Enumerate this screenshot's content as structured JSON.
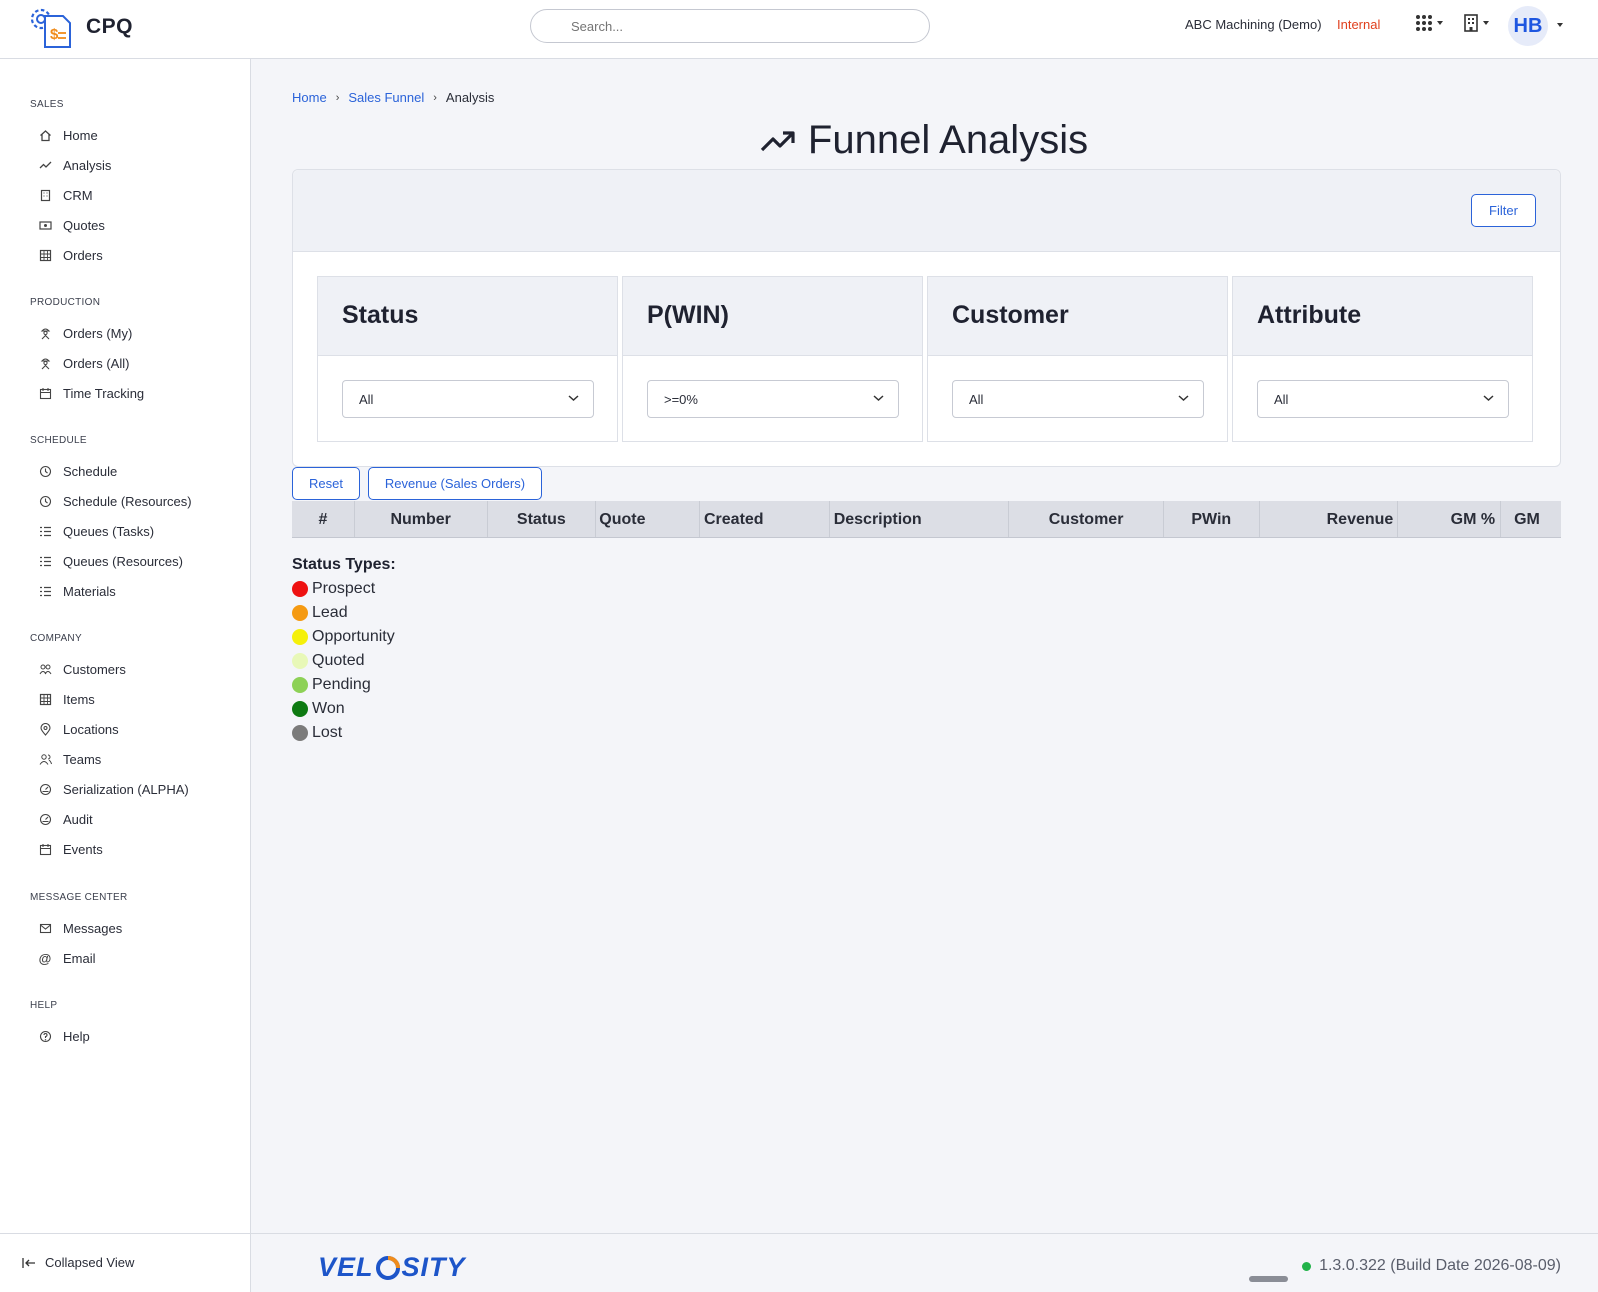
{
  "app": {
    "name": "CPQ",
    "search_placeholder": "Search...",
    "company": "ABC Machining (Demo)",
    "environment": "Internal",
    "avatar_initials": "HB"
  },
  "sidebar": {
    "sections": [
      {
        "title": "SALES",
        "items": [
          "Home",
          "Analysis",
          "CRM",
          "Quotes",
          "Orders"
        ]
      },
      {
        "title": "PRODUCTION",
        "items": [
          "Orders (My)",
          "Orders (All)",
          "Time Tracking"
        ]
      },
      {
        "title": "SCHEDULE",
        "items": [
          "Schedule",
          "Schedule (Resources)",
          "Queues (Tasks)",
          "Queues (Resources)",
          "Materials"
        ]
      },
      {
        "title": "COMPANY",
        "items": [
          "Customers",
          "Items",
          "Locations",
          "Teams",
          "Serialization (ALPHA)",
          "Audit",
          "Events"
        ]
      },
      {
        "title": "MESSAGE CENTER",
        "items": [
          "Messages",
          "Email"
        ]
      },
      {
        "title": "HELP",
        "items": [
          "Help"
        ]
      }
    ],
    "collapsed_label": "Collapsed View"
  },
  "breadcrumb": {
    "home": "Home",
    "funnel": "Sales Funnel",
    "current": "Analysis"
  },
  "page_title": "Funnel Analysis",
  "filter_button": "Filter",
  "filters": [
    {
      "label": "Status",
      "value": "All"
    },
    {
      "label": "P(WIN)",
      "value": ">=0%"
    },
    {
      "label": "Customer",
      "value": "All"
    },
    {
      "label": "Attribute",
      "value": "All"
    }
  ],
  "actions": {
    "reset": "Reset",
    "revenue": "Revenue (Sales Orders)"
  },
  "table_columns": [
    "#",
    "Number",
    "Status",
    "Quote",
    "Created",
    "Description",
    "Customer",
    "PWin",
    "Revenue",
    "GM %",
    "GM"
  ],
  "legend": {
    "title": "Status Types:",
    "items": [
      {
        "label": "Prospect",
        "color": "#ee1111"
      },
      {
        "label": "Lead",
        "color": "#f59a12"
      },
      {
        "label": "Opportunity",
        "color": "#f5f00a"
      },
      {
        "label": "Quoted",
        "color": "#e8f8b8"
      },
      {
        "label": "Pending",
        "color": "#8dd156"
      },
      {
        "label": "Won",
        "color": "#0e7a12"
      },
      {
        "label": "Lost",
        "color": "#7b7b7b"
      }
    ]
  },
  "footer": {
    "logo_text_left": "VEL",
    "logo_text_right": "SITY",
    "version": "1.3.0.322 (Build Date 2026-08-09)"
  }
}
